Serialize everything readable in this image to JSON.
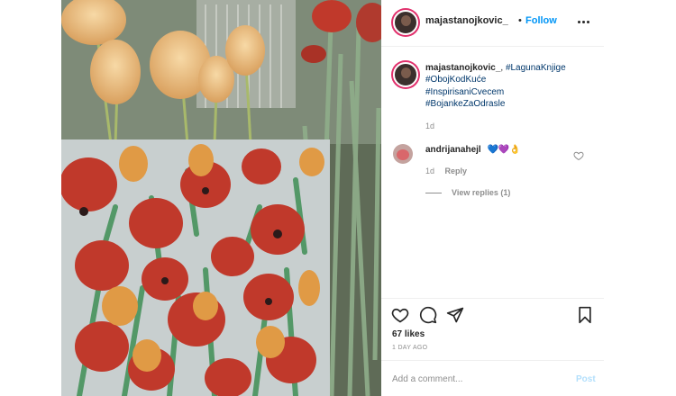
{
  "header": {
    "username": "majastanojkovic_",
    "separator": "•",
    "follow_label": "Follow"
  },
  "caption": {
    "username": "majastanojkovic_",
    "hashtags": [
      "#LagunaKnjige",
      "#ObojKodKuće",
      "#InspirisaniCvecem",
      "#BojankeZaOdrasle"
    ],
    "time": "1d"
  },
  "comment": {
    "username": "andrijanahejl",
    "text": "💙💜👌",
    "time": "1d",
    "reply_label": "Reply",
    "view_replies_label": "View replies (1)"
  },
  "actions": {
    "likes": "67 likes",
    "time_ago": "1 DAY AGO"
  },
  "add_comment": {
    "placeholder": "Add a comment...",
    "post_label": "Post"
  },
  "colors": {
    "follow": "#0095f6",
    "hashtag": "#00376b",
    "post_disabled": "#b2dffc",
    "story_ring": "#e1306c"
  },
  "icons": [
    "more-options-icon",
    "heart-icon",
    "comment-icon",
    "share-icon",
    "bookmark-icon"
  ]
}
